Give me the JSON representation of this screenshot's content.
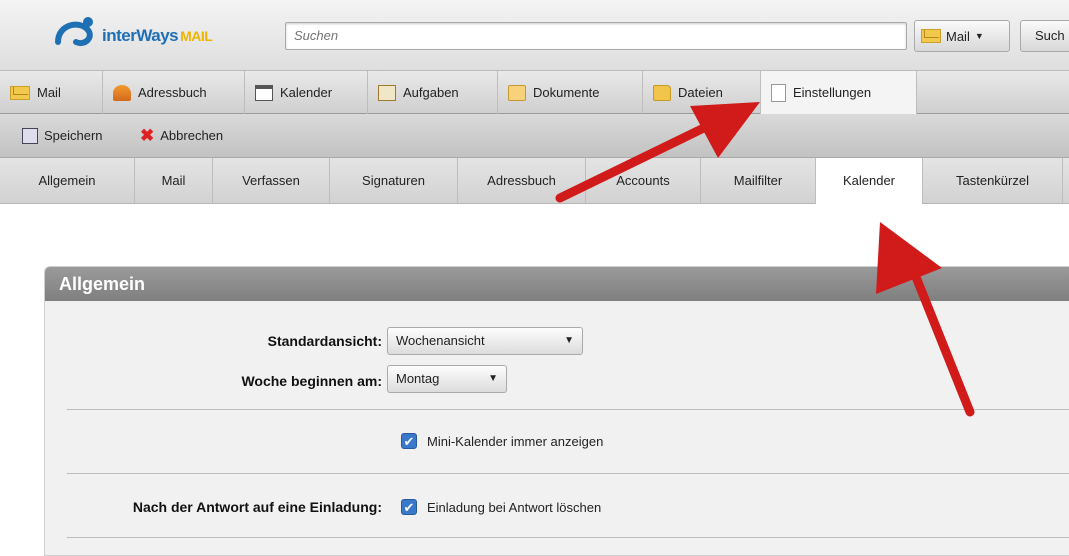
{
  "app": {
    "brand": "interWays",
    "brand_suffix": "MAIL"
  },
  "search": {
    "placeholder": "Suchen",
    "scope": "Mail",
    "button": "Such"
  },
  "apps": [
    {
      "label": "Mail",
      "icon": "mail-icon"
    },
    {
      "label": "Adressbuch",
      "icon": "addressbook-icon"
    },
    {
      "label": "Kalender",
      "icon": "calendar-icon"
    },
    {
      "label": "Aufgaben",
      "icon": "tasks-icon"
    },
    {
      "label": "Dokumente",
      "icon": "documents-icon"
    },
    {
      "label": "Dateien",
      "icon": "folder-icon"
    },
    {
      "label": "Einstellungen",
      "icon": "settings-icon",
      "active": true
    }
  ],
  "toolbar": {
    "save": "Speichern",
    "cancel": "Abbrechen"
  },
  "tabs": [
    "Allgemein",
    "Mail",
    "Verfassen",
    "Signaturen",
    "Adressbuch",
    "Accounts",
    "Mailfilter",
    "Kalender",
    "Tastenkürzel"
  ],
  "active_tab": "Kalender",
  "section": {
    "title": "Allgemein",
    "default_view_label": "Standardansicht:",
    "default_view_value": "Wochenansicht",
    "week_start_label": "Woche beginnen am:",
    "week_start_value": "Montag",
    "mini_calendar_label": "Mini-Kalender immer anzeigen",
    "invitation_label": "Nach der Antwort auf eine Einladung:",
    "invitation_option": "Einladung bei Antwort löschen"
  },
  "colors": {
    "arrow": "#d11a1a",
    "checkbox": "#3a78c9",
    "panel_header": "#8a8a8a"
  }
}
